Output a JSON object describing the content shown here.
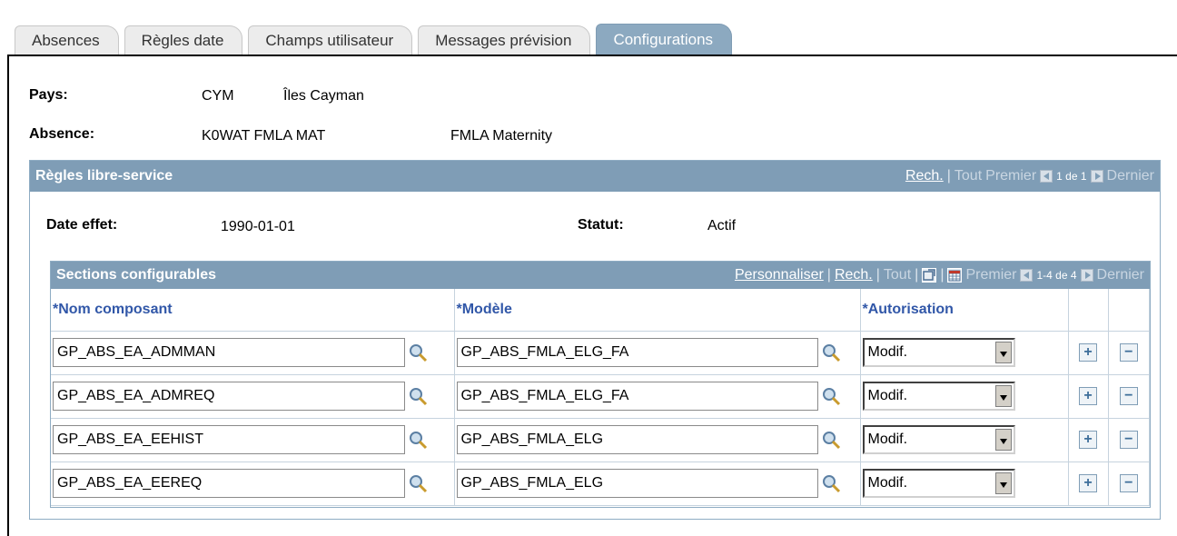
{
  "tabs": [
    {
      "label": "Absences",
      "active": false
    },
    {
      "label": "Règles date",
      "active": false
    },
    {
      "label": "Champs utilisateur",
      "active": false
    },
    {
      "label": "Messages prévision",
      "active": false
    },
    {
      "label": "Configurations",
      "active": true
    }
  ],
  "header": {
    "country_label": "Pays:",
    "country_code": "CYM",
    "country_name": "Îles Cayman",
    "absence_label": "Absence:",
    "absence_code": "K0WAT FMLA MAT",
    "absence_name": "FMLA Maternity"
  },
  "rules_group": {
    "title": "Règles libre-service",
    "nav": {
      "search": "Rech.",
      "sep": "|",
      "all": "Tout",
      "first": "Premier",
      "count": "1 de 1",
      "last": "Dernier"
    },
    "effdt_label": "Date effet:",
    "effdt_value": "1990-01-01",
    "status_label": "Statut:",
    "status_value": "Actif"
  },
  "sections_grid": {
    "title": "Sections configurables",
    "nav": {
      "customize": "Personnaliser",
      "search": "Rech.",
      "all": "Tout",
      "first": "Premier",
      "count": "1-4 de 4",
      "last": "Dernier"
    },
    "columns": [
      "*Nom composant",
      "*Modèle",
      "*Autorisation"
    ],
    "rows": [
      {
        "component": "GP_ABS_EA_ADMMAN",
        "template": "GP_ABS_FMLA_ELG_FA",
        "authorization": "Modif."
      },
      {
        "component": "GP_ABS_EA_ADMREQ",
        "template": "GP_ABS_FMLA_ELG_FA",
        "authorization": "Modif."
      },
      {
        "component": "GP_ABS_EA_EEHIST",
        "template": "GP_ABS_FMLA_ELG",
        "authorization": "Modif."
      },
      {
        "component": "GP_ABS_EA_EEREQ",
        "template": "GP_ABS_FMLA_ELG",
        "authorization": "Modif."
      }
    ],
    "add_symbol": "+",
    "delete_symbol": "−"
  },
  "colors": {
    "accent": "#7f9db6",
    "header_text": "#3157a8"
  }
}
